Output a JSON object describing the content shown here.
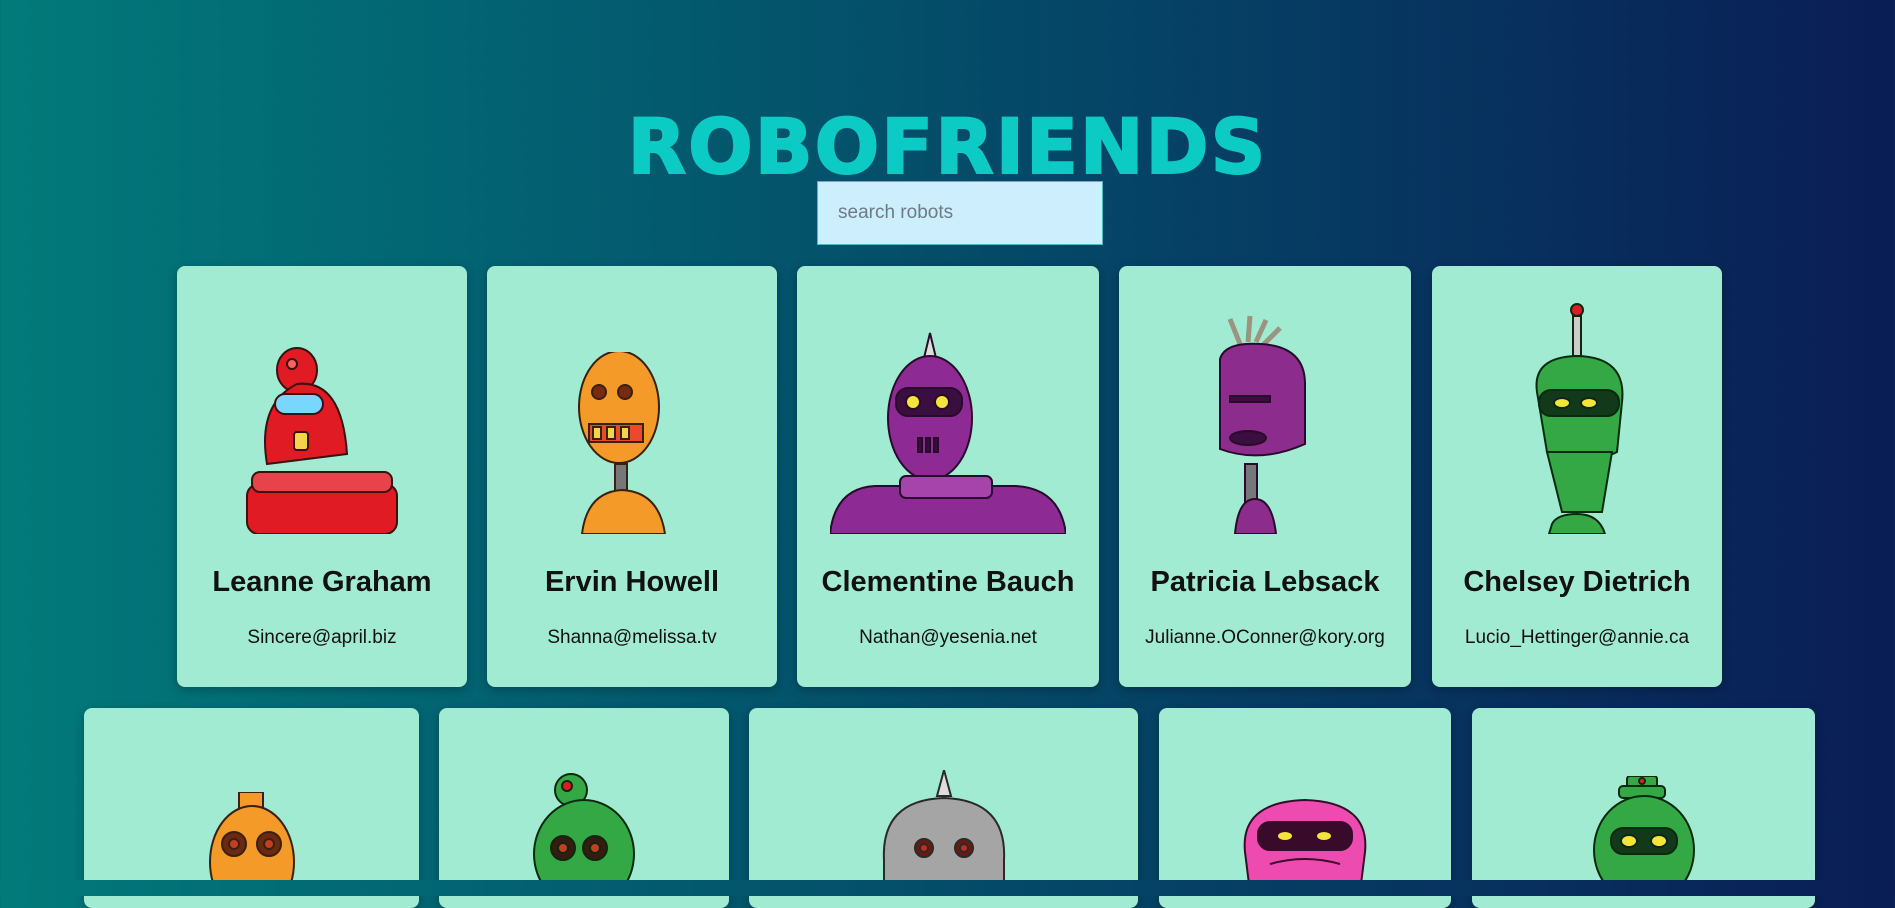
{
  "app": {
    "title": "ROBOFRIENDS"
  },
  "search": {
    "placeholder": "search robots",
    "value": ""
  },
  "robots": [
    {
      "name": "Leanne Graham",
      "email": "Sincere@april.biz",
      "color": "#e01b24"
    },
    {
      "name": "Ervin Howell",
      "email": "Shanna@melissa.tv",
      "color": "#f39a28"
    },
    {
      "name": "Clementine Bauch",
      "email": "Nathan@yesenia.net",
      "color": "#8e2a93"
    },
    {
      "name": "Patricia Lebsack",
      "email": "Julianne.OConner@kory.org",
      "color": "#8c2c8d"
    },
    {
      "name": "Chelsey Dietrich",
      "email": "Lucio_Hettinger@annie.ca",
      "color": "#33a844"
    },
    {
      "name": "",
      "email": "",
      "color": "#f39a28"
    },
    {
      "name": "",
      "email": "",
      "color": "#33a844"
    },
    {
      "name": "",
      "email": "",
      "color": "#a5a5a5"
    },
    {
      "name": "",
      "email": "",
      "color": "#ee4bb0"
    },
    {
      "name": "",
      "email": "",
      "color": "#33a844"
    }
  ]
}
